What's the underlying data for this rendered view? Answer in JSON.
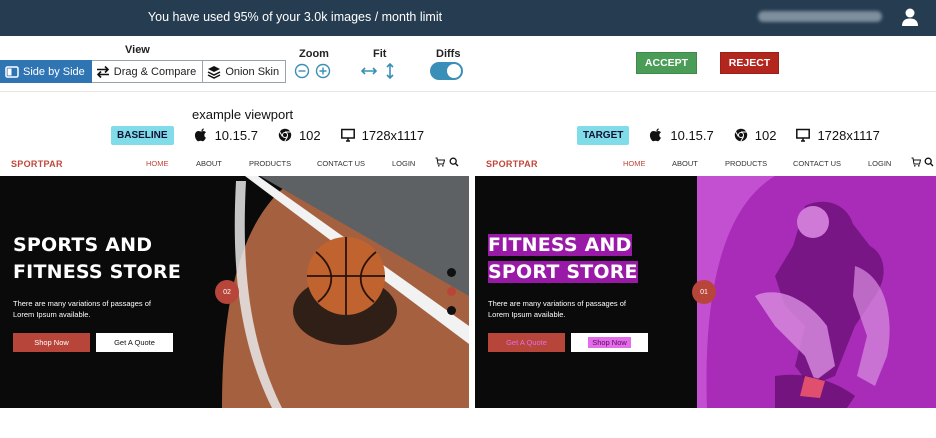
{
  "banner": {
    "message": "You have used 95% of your 3.0k images / month limit",
    "user_icon": "user-icon"
  },
  "toolbar": {
    "view_label": "View",
    "views": [
      {
        "label": "Side by Side",
        "icon": "side-by-side-icon",
        "active": true
      },
      {
        "label": "Drag & Compare",
        "icon": "swap-icon",
        "active": false
      },
      {
        "label": "Onion Skin",
        "icon": "layers-icon",
        "active": false
      }
    ],
    "zoom_label": "Zoom",
    "fit_label": "Fit",
    "diffs_label": "Diffs",
    "diffs_enabled": true,
    "accept_label": "ACCEPT",
    "reject_label": "REJECT",
    "colors": {
      "active": "#2f74b3",
      "accept": "#4a9c56",
      "reject": "#b3261e",
      "toggle": "#3a8fb8"
    }
  },
  "viewport": {
    "title": "example viewport",
    "baseline": {
      "tag": "BASELINE",
      "os_version": "10.15.7",
      "browser_version": "102",
      "resolution": "1728x1117"
    },
    "target": {
      "tag": "TARGET",
      "os_version": "10.15.7",
      "browser_version": "102",
      "resolution": "1728x1117"
    }
  },
  "baseline_page": {
    "brand": "SPORTPAR",
    "nav": [
      "HOME",
      "ABOUT",
      "PRODUCTS",
      "CONTACT US",
      "LOGIN"
    ],
    "headline_1": "SPORTS AND",
    "headline_2": "FITNESS STORE",
    "body_1": "There are many variations of passages of",
    "body_2": "Lorem Ipsum available.",
    "shop_button": "Shop Now",
    "quote_button": "Get A Quote",
    "slide": "02"
  },
  "target_page": {
    "brand": "SPORTPAR",
    "nav": [
      "HOME",
      "ABOUT",
      "PRODUCTS",
      "CONTACT US",
      "LOGIN"
    ],
    "headline_1": "FITNESS AND",
    "headline_2": "SPORT STORE",
    "body_1": "There are many variations of passages of",
    "body_2": "Lorem Ipsum available.",
    "shop_button": "Get A Quote",
    "quote_button": "Shop Now",
    "slide": "01",
    "diff_color": "#c02cd0"
  }
}
